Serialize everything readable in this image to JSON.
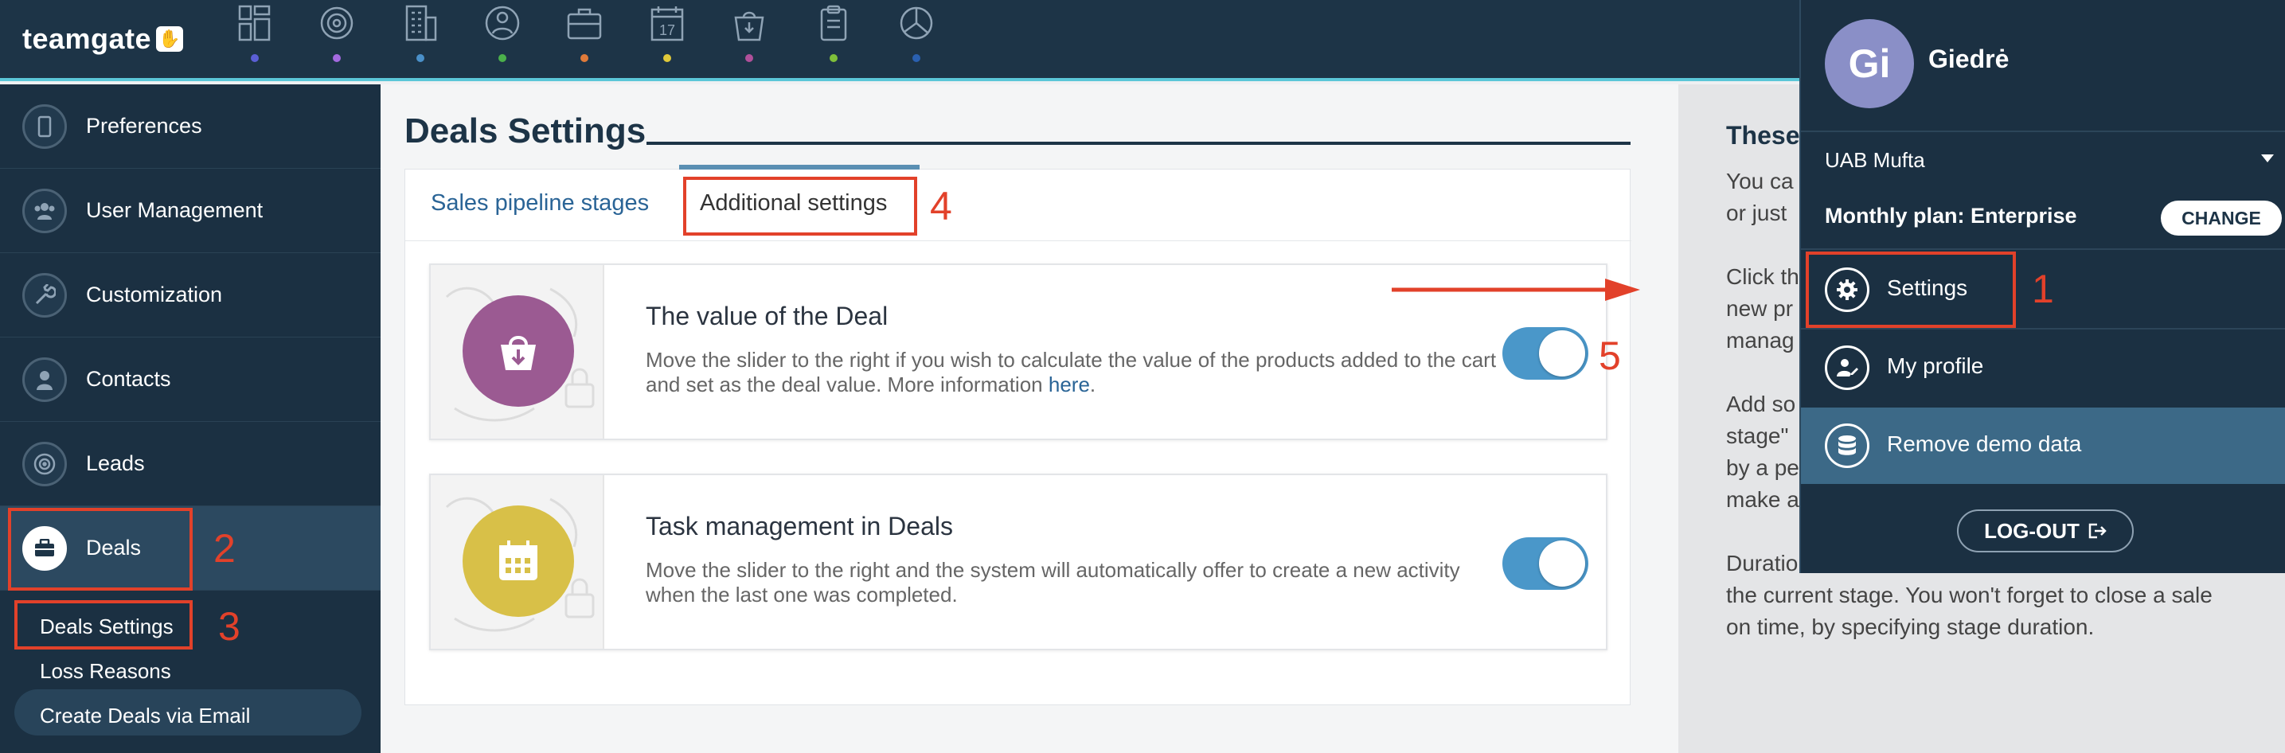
{
  "app": {
    "logo_text": "teamgate",
    "logo_badge": "✋"
  },
  "top_nav": [
    {
      "icon": "dashboard-icon",
      "dot_color": "#5b5fd6"
    },
    {
      "icon": "target-icon",
      "dot_color": "#a46ae0"
    },
    {
      "icon": "building-icon",
      "dot_color": "#4a90c9"
    },
    {
      "icon": "contacts-icon",
      "dot_color": "#4bb04b"
    },
    {
      "icon": "briefcase-icon",
      "dot_color": "#e07b3a"
    },
    {
      "icon": "calendar-icon",
      "dot_color": "#e0c93a"
    },
    {
      "icon": "bag-icon",
      "dot_color": "#b0509a"
    },
    {
      "icon": "clipboard-icon",
      "dot_color": "#7fbf3a"
    },
    {
      "icon": "pie-chart-icon",
      "dot_color": "#2a60b0"
    }
  ],
  "calendar_day": "17",
  "sidebar": {
    "items": [
      {
        "label": "Preferences",
        "icon": "phone-icon"
      },
      {
        "label": "User Management",
        "icon": "users-icon"
      },
      {
        "label": "Customization",
        "icon": "wrench-icon"
      },
      {
        "label": "Contacts",
        "icon": "person-icon"
      },
      {
        "label": "Leads",
        "icon": "target-icon"
      },
      {
        "label": "Deals",
        "icon": "briefcase-icon",
        "active": true
      }
    ],
    "sub_items": [
      "Deals Settings",
      "Loss Reasons",
      "Create Deals via Email"
    ]
  },
  "main": {
    "title": "Deals Settings",
    "tabs": [
      {
        "label": "Sales pipeline stages"
      },
      {
        "label": "Additional settings",
        "active": true
      }
    ],
    "settings": [
      {
        "title": "The value of the Deal",
        "description": "Move the slider to the right if you wish to calculate the value of the products added to the cart and set as the deal value. More information",
        "link_text": "here",
        "suffix": ".",
        "enabled": true,
        "icon": "bag-download-icon",
        "icon_color": "#9b5a92"
      },
      {
        "title": "Task management in Deals",
        "description": "Move the slider to the right and the system will automatically offer to create a new activity when the last one was completed.",
        "enabled": true,
        "icon": "calendar-icon",
        "icon_color": "#d8c048"
      }
    ]
  },
  "help_panel": {
    "title": "These",
    "lines": [
      "You ca",
      "or just",
      "Click th",
      "new pr",
      "manag",
      "Add so",
      "stage\"",
      "by a pe",
      "make a",
      "Duratio",
      "the current stage. You won't forget to close a sale",
      "on time, by specifying stage duration."
    ]
  },
  "account_menu": {
    "avatar_initials": "Gi",
    "avatar_color": "#8a8fc7",
    "user_name": "Giedrė",
    "company": "UAB Mufta",
    "plan": "Monthly plan: Enterprise",
    "change_label": "CHANGE",
    "items": [
      {
        "label": "Settings",
        "icon": "gear-icon"
      },
      {
        "label": "My profile",
        "icon": "profile-edit-icon"
      },
      {
        "label": "Remove demo data",
        "icon": "database-icon",
        "highlight": true
      }
    ],
    "logout_label": "LOG-OUT"
  },
  "annotations": [
    "1",
    "2",
    "3",
    "4",
    "5"
  ],
  "colors": {
    "accent": "#5bc6d8",
    "navy": "#1d3447",
    "toggle": "#4a97c9",
    "annotation": "#e2412a"
  }
}
